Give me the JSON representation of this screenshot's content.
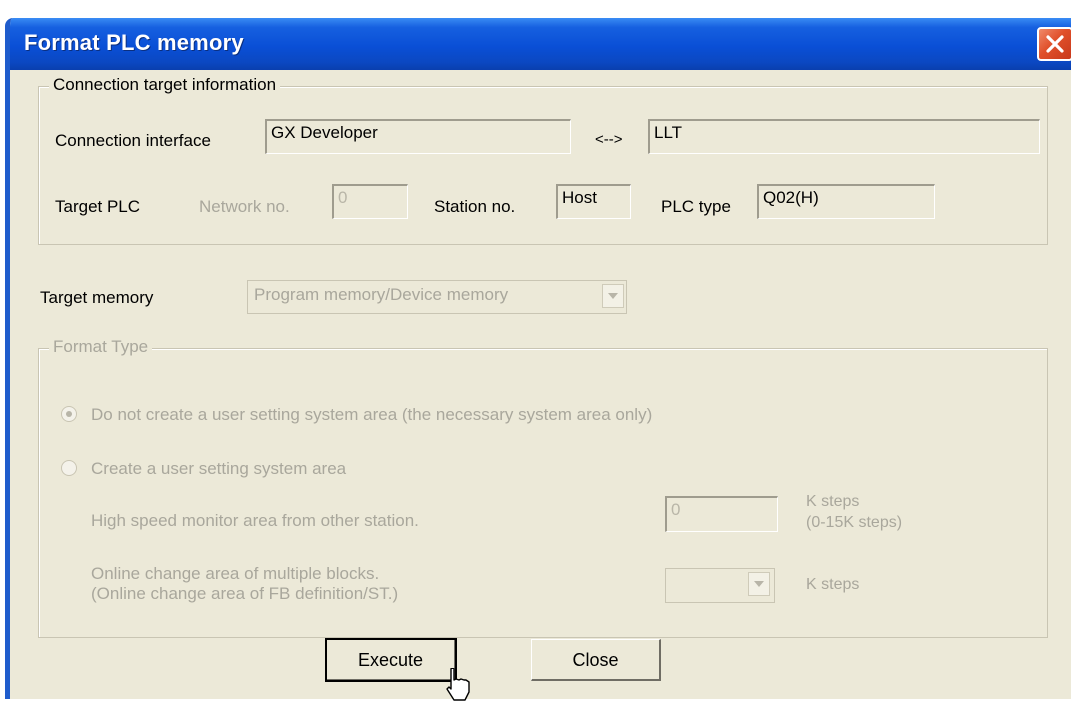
{
  "dialog": {
    "title": "Format PLC memory",
    "close_icon": "close-icon"
  },
  "connection_group": {
    "legend": "Connection target information",
    "interface_label": "Connection interface",
    "interface_value": "GX Developer",
    "arrow_text": "<-->",
    "target_value": "LLT",
    "target_plc_label": "Target PLC",
    "network_label": "Network no.",
    "network_value": "0",
    "station_label": "Station no.",
    "station_value": "Host",
    "plc_type_label": "PLC type",
    "plc_type_value": "Q02(H)"
  },
  "target_memory": {
    "label": "Target memory",
    "selected": "Program memory/Device memory"
  },
  "format_type": {
    "legend": "Format Type",
    "option1": "Do not create a user setting system area (the necessary system area only)",
    "option2": "Create a user setting system area",
    "high_speed_label": "High speed monitor area from other station.",
    "high_speed_value": "0",
    "k_steps_1": "K steps",
    "k_steps_range": "(0-15K steps)",
    "online_change_label_1": "Online change area of multiple blocks.",
    "online_change_label_2": "(Online change area of FB definition/ST.)",
    "online_change_value": "",
    "k_steps_2": "K steps"
  },
  "buttons": {
    "execute": "Execute",
    "close": "Close"
  },
  "colors": {
    "titlebar": "#0a4fd6",
    "dialog_bg": "#ece9d8",
    "disabled_text": "#a9a79c",
    "close_button": "#e0502a"
  }
}
